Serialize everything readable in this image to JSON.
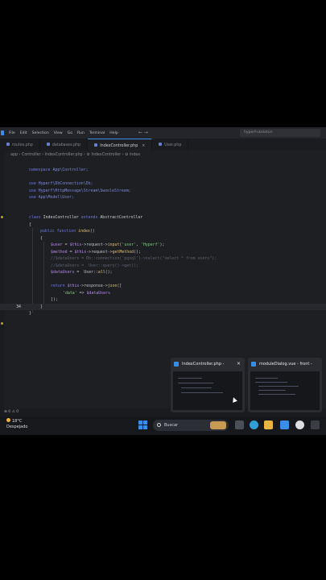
{
  "menu": [
    "File",
    "Edit",
    "Selection",
    "View",
    "Go",
    "Run",
    "Terminal",
    "Help"
  ],
  "nav_arrows": "← →",
  "command_center": "hyperf-skeleton",
  "tabs": [
    {
      "label": "routes.php",
      "active": false
    },
    {
      "label": "databases.php",
      "active": false
    },
    {
      "label": "IndexController.php",
      "active": true
    },
    {
      "label": "User.php",
      "active": false
    }
  ],
  "tab_close": "×",
  "breadcrumb": "app  ›  Controller  ›  IndexController.php  ›  ⚙ IndexController  ›  ⚙ index",
  "active_line_number": "34",
  "code": {
    "l1a": "namespace ",
    "l1b": "App\\Controller;",
    "l2a": "use ",
    "l2b": "Hyperf\\DbConnection\\Db;",
    "l3a": "use ",
    "l3b": "Hyperf\\HttpMessage\\Stream\\SwooleStream;",
    "l4a": "use ",
    "l4b": "App\\Model\\User;",
    "l5a": "class ",
    "l5b": "IndexController ",
    "l5c": "extends ",
    "l5d": "AbstractController",
    "l6": "{",
    "l7a": "public function ",
    "l7b": "index",
    "l7c": "()",
    "l8": "{",
    "l9a": "$user ",
    "l9b": "= ",
    "l9c": "$this",
    "l9d": "->request->",
    "l9e": "input",
    "l9f": "(",
    "l9g": "'user'",
    "l9h": ", ",
    "l9i": "'Hyperf'",
    "l9j": ");",
    "l10a": "$method ",
    "l10b": "= ",
    "l10c": "$this",
    "l10d": "->request->",
    "l10e": "getMethod",
    "l10f": "();",
    "l11": "//$dataUsers = Db::connection('pgsql')->select(\"select * from users\");",
    "l12": "//$dataUsers =  User::query()->get();",
    "l13a": "$dataUsers ",
    "l13b": "=  User::",
    "l13c": "all",
    "l13d": "();",
    "l14a": "return ",
    "l14b": "$this",
    "l14c": "->response->",
    "l14d": "json",
    "l14e": "([",
    "l15a": "'data' ",
    "l15b": "=> ",
    "l15c": "$dataUsers",
    "l16": "]);",
    "l17": "}",
    "l18": "}"
  },
  "status_bar": "⊗ 0  ⚠ 0",
  "taskbar": {
    "temperature": "18°C",
    "weather": "Despejado",
    "search_label": "Buscar"
  },
  "previews": [
    {
      "title": "IndexController.php -",
      "close": "×"
    },
    {
      "title": "moduleDialog.vue - front -",
      "close": ""
    }
  ],
  "colors": {
    "accent": "#3d8be8",
    "keyword": "#6f79e0",
    "variable": "#b48ae8",
    "string": "#86c48a",
    "function": "#e2c07a"
  }
}
